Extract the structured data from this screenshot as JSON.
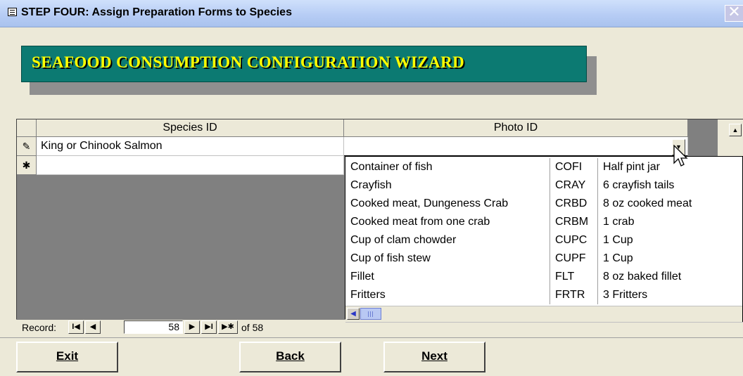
{
  "window": {
    "title": "STEP FOUR:  Assign Preparation Forms to Species",
    "close_glyph": "✕",
    "form_icon": "form-icon"
  },
  "banner": {
    "text": "SEAFOOD CONSUMPTION CONFIGURATION WIZARD"
  },
  "datasheet": {
    "columns": [
      "Species ID",
      "Photo ID"
    ],
    "rows": [
      {
        "selector_glyph": "✎",
        "species": "King or Chinook Salmon",
        "photo": ""
      },
      {
        "selector_glyph": "✱",
        "species": "",
        "photo": ""
      }
    ]
  },
  "dropdown": {
    "items": [
      [
        "Container of fish",
        "COFI",
        "Half pint jar"
      ],
      [
        "Crayfish",
        "CRAY",
        "6 crayfish tails"
      ],
      [
        "Cooked meat, Dungeness Crab",
        "CRBD",
        "8 oz cooked meat"
      ],
      [
        "Cooked meat from one crab",
        "CRBM",
        "1 crab"
      ],
      [
        "Cup of clam chowder",
        "CUPC",
        "1 Cup"
      ],
      [
        "Cup of fish stew",
        "CUPF",
        "1 Cup"
      ],
      [
        "Fillet",
        "FLT",
        "8 oz baked fillet"
      ],
      [
        "Fritters",
        "FRTR",
        "3 Fritters"
      ]
    ]
  },
  "navigator": {
    "label": "Record:",
    "current": "58",
    "of_text": "of 58",
    "first": "I◀",
    "prev": "◀",
    "next": "▶",
    "last": "▶I",
    "new": "▶✱"
  },
  "buttons": {
    "exit": "Exit",
    "back": "Back",
    "next": "Next"
  }
}
